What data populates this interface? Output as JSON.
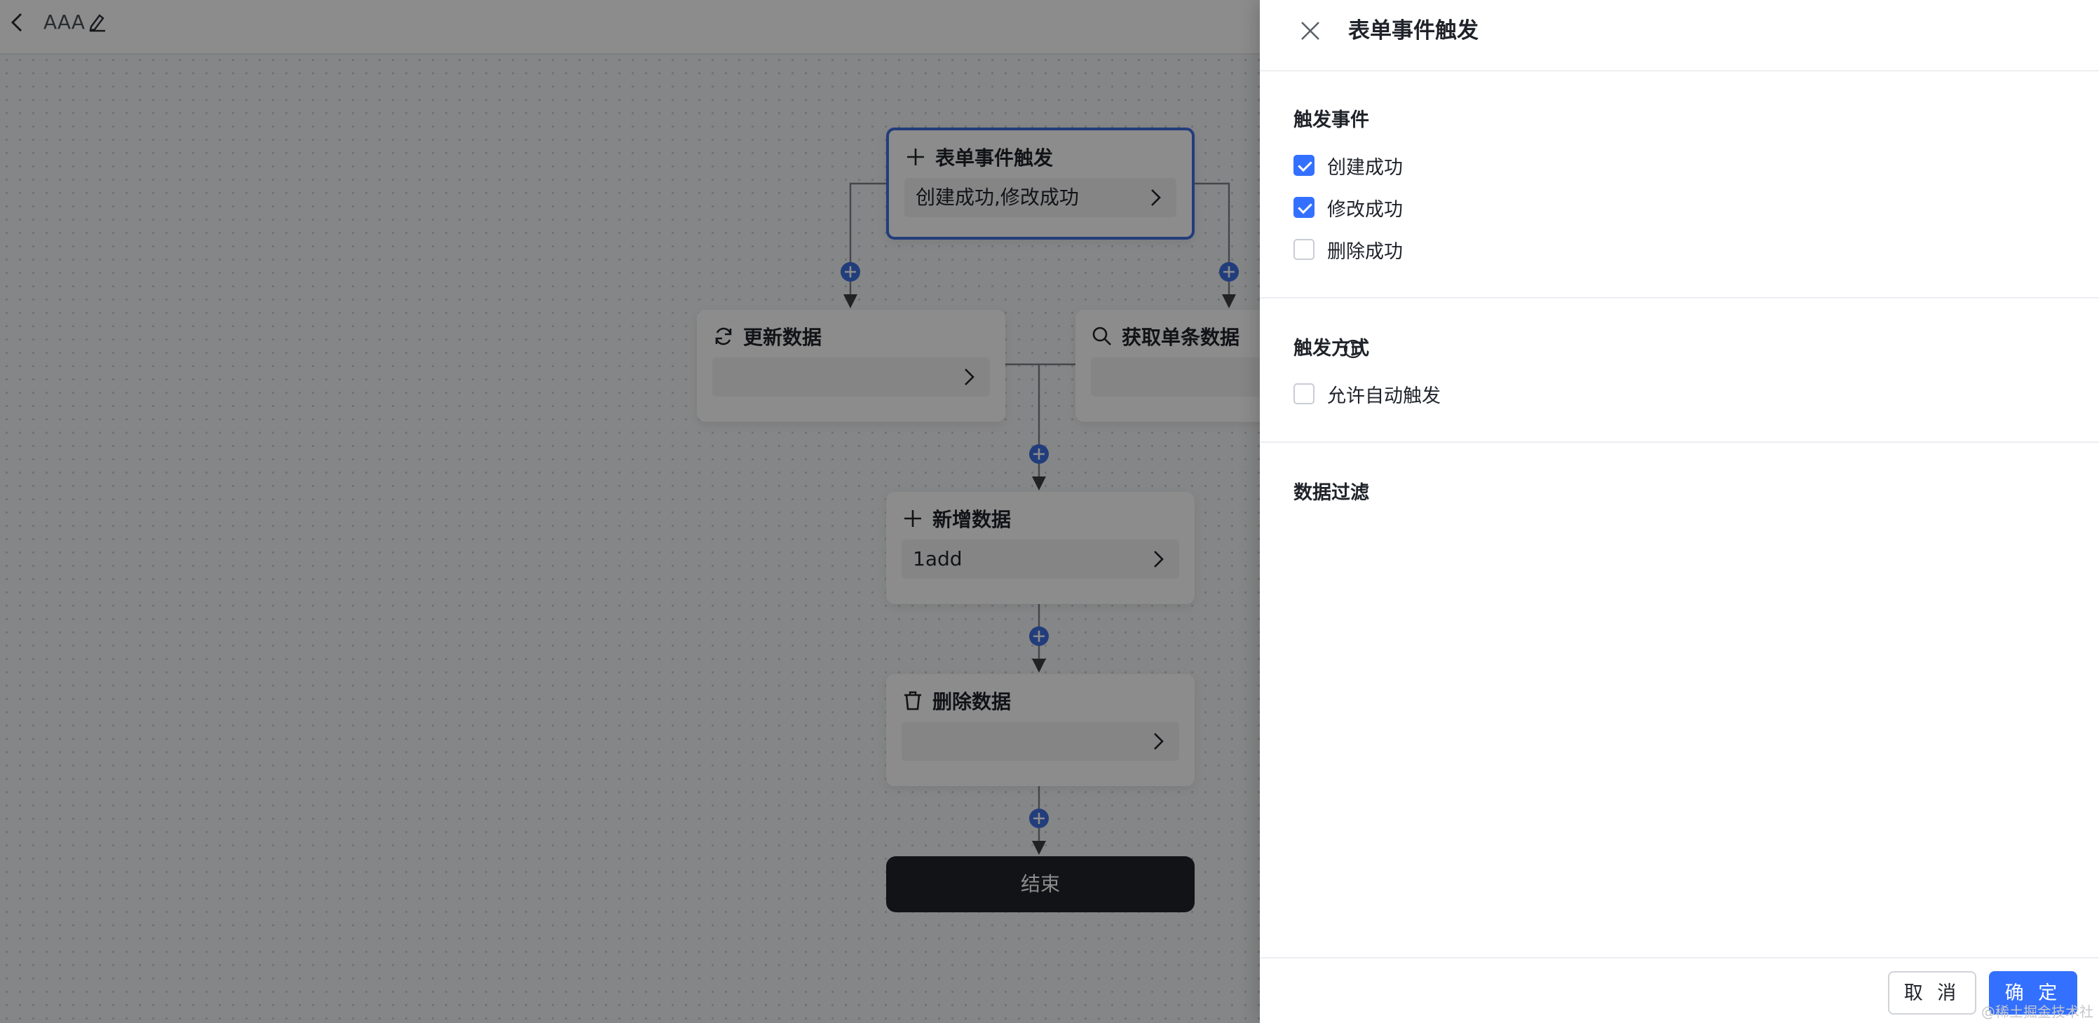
{
  "app": {
    "title": "AAA"
  },
  "flow": {
    "trigger": {
      "title": "表单事件触发",
      "value": "创建成功,修改成功"
    },
    "update": {
      "title": "更新数据",
      "value": ""
    },
    "fetch": {
      "title": "获取单条数据",
      "value": ""
    },
    "add": {
      "title": "新增数据",
      "value": "1add"
    },
    "delete": {
      "title": "删除数据",
      "value": ""
    },
    "end": {
      "label": "结束"
    }
  },
  "drawer": {
    "title": "表单事件触发",
    "events": {
      "title": "触发事件",
      "options": [
        {
          "label": "创建成功",
          "checked": true
        },
        {
          "label": "修改成功",
          "checked": true
        },
        {
          "label": "删除成功",
          "checked": false
        }
      ]
    },
    "mode": {
      "title": "触发方式",
      "options": [
        {
          "label": "允许自动触发",
          "checked": false
        }
      ]
    },
    "filter": {
      "title": "数据过滤"
    },
    "footer": {
      "cancel": "取 消",
      "ok": "确 定"
    }
  },
  "watermark": "@稀土掘金技术社区",
  "colors": {
    "accent": "#3370ff",
    "node_border": "#3e6fe0",
    "end_node": "#1f2329"
  },
  "icons": [
    "back-icon",
    "edit-icon",
    "plus-icon",
    "refresh-icon",
    "search-icon",
    "trash-icon",
    "chevron-right-icon",
    "add-circle-icon",
    "close-icon",
    "info-icon"
  ]
}
